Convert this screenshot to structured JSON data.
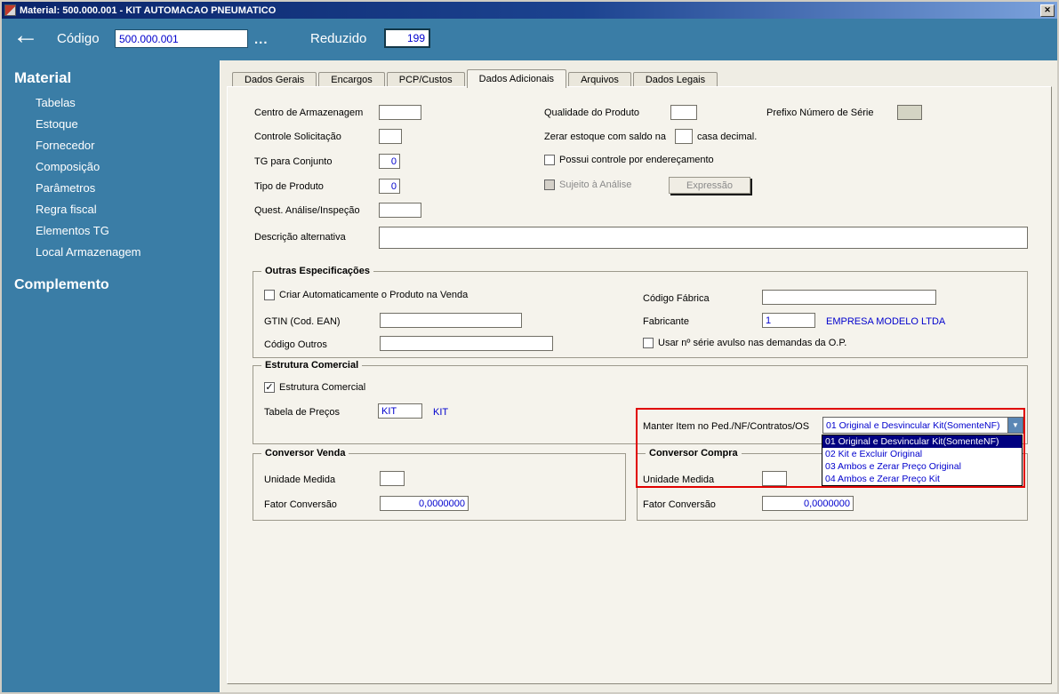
{
  "window": {
    "title": "Material: 500.000.001 - KIT AUTOMACAO PNEUMATICO"
  },
  "icons": {
    "close": "✕",
    "back": "←",
    "dropdown": "▼",
    "check": "✓"
  },
  "colors": {
    "accent_teal": "#3a7da6",
    "value_text": "#0000cd",
    "selection_bg": "#000080",
    "annotation_red": "#e00000"
  },
  "header": {
    "codigo_label": "Código",
    "codigo_value": "500.000.001",
    "browse_label": "...",
    "reduzido_label": "Reduzido",
    "reduzido_value": "199"
  },
  "sidebar": {
    "section1": "Material",
    "items": [
      "Tabelas",
      "Estoque",
      "Fornecedor",
      "Composição",
      "Parâmetros",
      "Regra fiscal",
      "Elementos TG",
      "Local Armazenagem"
    ],
    "section2": "Complemento"
  },
  "tabs": [
    "Dados Gerais",
    "Encargos",
    "PCP/Custos",
    "Dados Adicionais",
    "Arquivos",
    "Dados Legais"
  ],
  "page": {
    "centro_label": "Centro de Armazenagem",
    "centro_value": "",
    "qualidade_label": "Qualidade do Produto",
    "qualidade_value": "",
    "prefixo_label": "Prefixo Número de Série",
    "prefixo_value": "",
    "controle_label": "Controle Solicitação",
    "controle_value": "",
    "zerar_label": "Zerar estoque com saldo na",
    "zerar_value": "",
    "zerar_suffix": "casa decimal.",
    "tg_label": "TG para Conjunto",
    "tg_value": "0",
    "enderec_label": "Possui controle por endereçamento",
    "tipo_label": "Tipo de Produto",
    "tipo_value": "0",
    "sujeito_label": "Sujeito à Análise",
    "expressao_label": "Expressão",
    "quest_label": "Quest. Análise/Inspeção",
    "quest_value": "",
    "descricao_label": "Descrição alternativa",
    "descricao_value": ""
  },
  "outras": {
    "title": "Outras Especificações",
    "criar_auto_label": "Criar Automaticamente o Produto na Venda",
    "codigo_fabrica_label": "Código Fábrica",
    "codigo_fabrica_value": "",
    "gtin_label": "GTIN (Cod. EAN)",
    "gtin_value": "",
    "fabricante_label": "Fabricante",
    "fabricante_value": "1",
    "fabricante_name": "EMPRESA MODELO LTDA",
    "codigo_outros_label": "Código Outros",
    "codigo_outros_value": "",
    "usar_serie_label": "Usar nº série avulso nas demandas da O.P."
  },
  "estrutura": {
    "title": "Estrutura Comercial",
    "checkbox_label": "Estrutura Comercial",
    "tabela_label": "Tabela de Preços",
    "tabela_value": "KIT",
    "tabela_desc": "KIT",
    "manter_label": "Manter Item no Ped./NF/Contratos/OS",
    "manter_value": "01 Original e Desvincular Kit(SomenteNF)",
    "options": [
      "01 Original e Desvincular Kit(SomenteNF)",
      "02 Kit e Excluir Original",
      "03 Ambos e Zerar Preço Original",
      "04 Ambos e Zerar Preço Kit"
    ]
  },
  "conversor_venda": {
    "title": "Conversor Venda",
    "unidade_label": "Unidade Medida",
    "unidade_value": "",
    "fator_label": "Fator Conversão",
    "fator_value": "0,0000000"
  },
  "conversor_compra": {
    "title": "Conversor Compra",
    "unidade_label": "Unidade Medida",
    "unidade_value": "",
    "fator_label": "Fator Conversão",
    "fator_value": "0,0000000"
  }
}
